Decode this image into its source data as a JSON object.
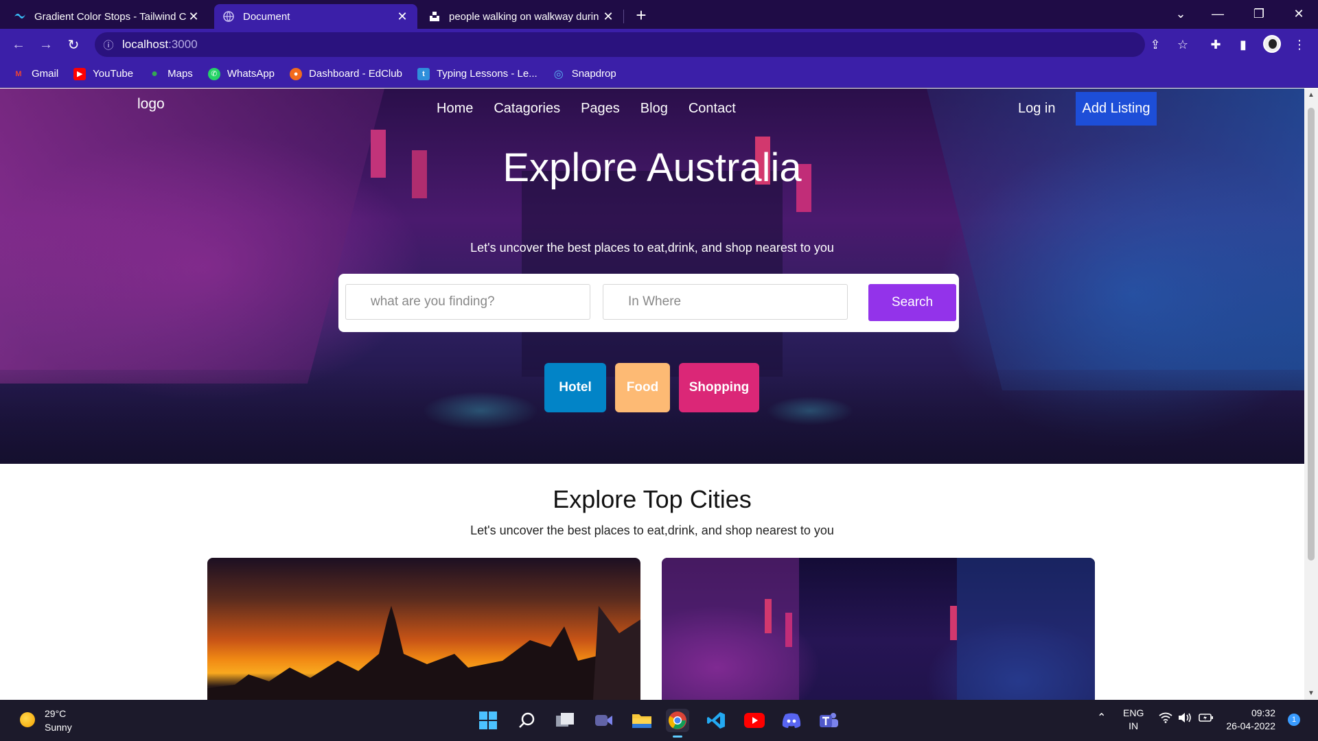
{
  "browser": {
    "tabs": [
      {
        "title": "Gradient Color Stops - Tailwind C",
        "icon": "tailwind-icon"
      },
      {
        "title": "Document",
        "icon": "globe-icon"
      },
      {
        "title": "people walking on walkway durin",
        "icon": "unsplash-icon"
      }
    ],
    "new_tab": "+",
    "url_host": "localhost",
    "url_port": ":3000",
    "bookmarks": [
      {
        "label": "Gmail",
        "icon": "gmail-icon",
        "color": "#ea4335"
      },
      {
        "label": "YouTube",
        "icon": "youtube-icon",
        "color": "#ff0000"
      },
      {
        "label": "Maps",
        "icon": "maps-icon",
        "color": "#34a853"
      },
      {
        "label": "WhatsApp",
        "icon": "whatsapp-icon",
        "color": "#25d366"
      },
      {
        "label": "Dashboard - EdClub",
        "icon": "edclub-icon",
        "color": "#f26b1d"
      },
      {
        "label": "Typing Lessons - Le...",
        "icon": "typing-icon",
        "color": "#2f8fdb"
      },
      {
        "label": "Snapdrop",
        "icon": "snapdrop-icon",
        "color": "#5ab4f0"
      }
    ]
  },
  "page": {
    "logo": "logo",
    "nav": [
      "Home",
      "Catagories",
      "Pages",
      "Blog",
      "Contact"
    ],
    "login": "Log in",
    "add_listing": "Add Listing",
    "hero_title": "Explore Australia",
    "hero_subtitle": "Let's uncover the best places to eat,drink, and shop nearest to you",
    "search": {
      "what_placeholder": "what are you finding?",
      "where_placeholder": "In Where",
      "button": "Search"
    },
    "categories": [
      {
        "label": "Hotel",
        "color": "#0284c7"
      },
      {
        "label": "Food",
        "color": "#fdba74"
      },
      {
        "label": "Shopping",
        "color": "#db2777"
      }
    ],
    "section_title": "Explore Top Cities",
    "section_subtitle": "Let's uncover the best places to eat,drink, and shop nearest to you"
  },
  "taskbar": {
    "weather_temp": "29°C",
    "weather_desc": "Sunny",
    "apps": [
      "start-icon",
      "search-icon",
      "task-view-icon",
      "meet-icon",
      "file-explorer-icon",
      "chrome-icon",
      "vscode-icon",
      "youtube-icon",
      "discord-icon",
      "teams-icon"
    ],
    "lang_top": "ENG",
    "lang_bottom": "IN",
    "time": "09:32",
    "date": "26-04-2022",
    "notification_count": "1"
  },
  "colors": {
    "tabbar": "#1f0c46",
    "toolbar": "#3b1fa8",
    "add_listing": "#1d4ed8",
    "search_button": "#9333ea"
  }
}
